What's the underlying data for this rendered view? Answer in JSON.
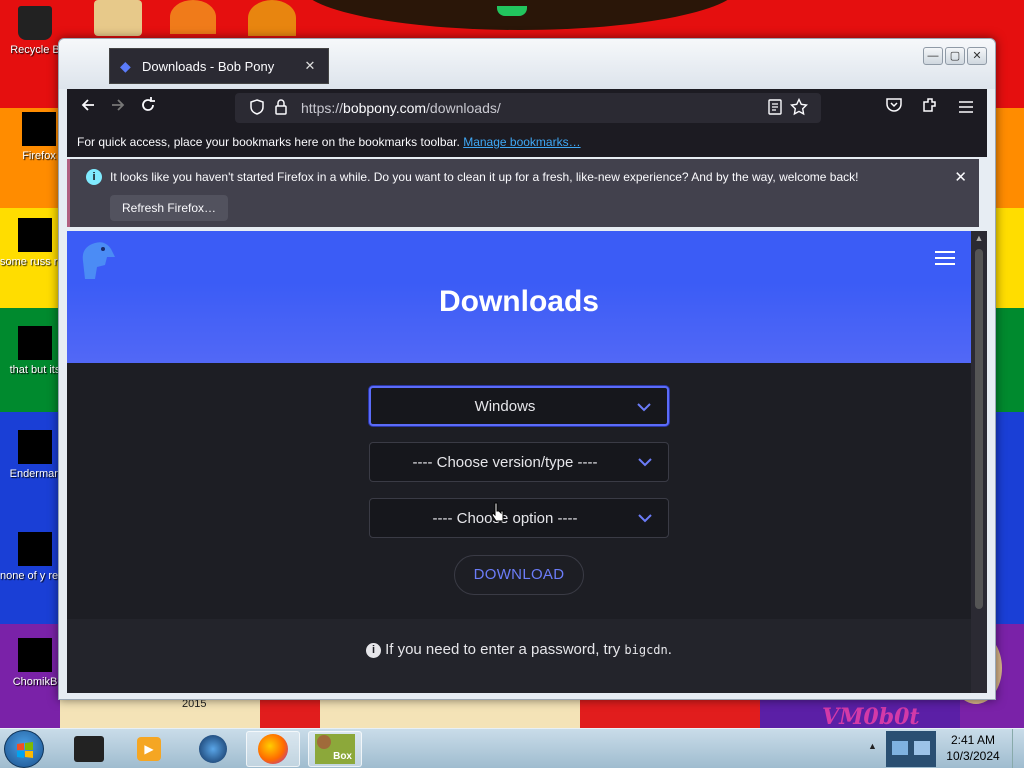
{
  "desktop": {
    "icons": [
      {
        "label": "Recycle B"
      },
      {
        "label": "Firefox"
      },
      {
        "label": "some russ ran a ra"
      },
      {
        "label": "that but its"
      },
      {
        "label": "Enderman"
      },
      {
        "label": "none of y retards kn"
      },
      {
        "label": "ChomikB"
      }
    ],
    "watermark": "VM0b0t",
    "year_label": "2015"
  },
  "browser": {
    "tab_title": "Downloads - Bob Pony",
    "url_prefix": "https://",
    "url_host": "bobpony.com",
    "url_path": "/downloads/",
    "bookmarks_text": "For quick access, place your bookmarks here on the bookmarks toolbar.",
    "bookmarks_link": "Manage bookmarks…",
    "notice_text": "It looks like you haven't started Firefox in a while. Do you want to clean it up for a fresh, like-new experience? And by the way, welcome back!",
    "refresh_label": "Refresh Firefox…"
  },
  "page": {
    "heading": "Downloads",
    "select_os": "Windows",
    "select_version": "---- Choose version/type ----",
    "select_option": "---- Choose option ----",
    "download_label": "DOWNLOAD",
    "pw_note_before": "If you need to enter a password, try",
    "pw_note_code": "bigcdn",
    "pw_note_after": "."
  },
  "taskbar": {
    "time": "2:41 AM",
    "date": "10/3/2024",
    "box_label": "Box"
  },
  "colors": {
    "brand_blue": "#3b5cf6",
    "accent_link": "#6b7cf8"
  },
  "icons": {
    "back": "arrow-left-icon",
    "forward": "arrow-right-icon",
    "reload": "reload-icon",
    "shield": "shield-icon",
    "lock": "lock-icon",
    "reader": "reader-view-icon",
    "star": "bookmark-star-icon",
    "pocket": "pocket-icon",
    "extensions": "extensions-icon",
    "menu": "hamburger-menu-icon"
  }
}
